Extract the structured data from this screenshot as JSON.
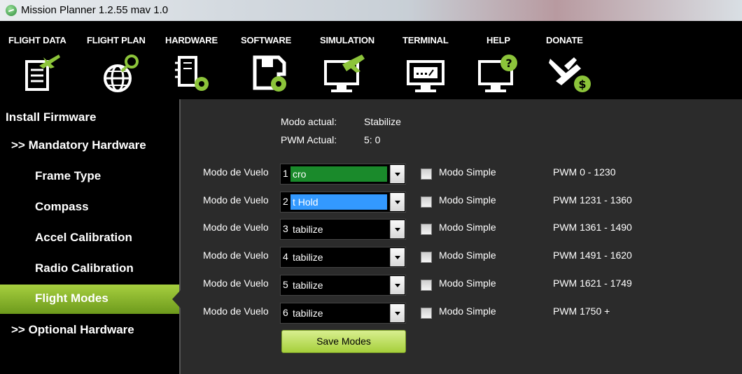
{
  "window": {
    "title": "Mission Planner 1.2.55 mav 1.0"
  },
  "menu": [
    {
      "label": "FLIGHT DATA",
      "icon": "flight-data-icon"
    },
    {
      "label": "FLIGHT PLAN",
      "icon": "globe-pin-icon"
    },
    {
      "label": "HARDWARE",
      "icon": "hardware-gear-icon"
    },
    {
      "label": "SOFTWARE",
      "icon": "save-gear-icon"
    },
    {
      "label": "SIMULATION",
      "icon": "monitor-plane-icon"
    },
    {
      "label": "TERMINAL",
      "icon": "monitor-terminal-icon"
    },
    {
      "label": "HELP",
      "icon": "monitor-question-icon"
    },
    {
      "label": "DONATE",
      "icon": "plane-dollar-icon"
    }
  ],
  "sidebar": {
    "items": [
      {
        "label": "Install Firmware"
      },
      {
        "label": ">> Mandatory Hardware"
      },
      {
        "label": "Frame Type"
      },
      {
        "label": "Compass"
      },
      {
        "label": "Accel Calibration"
      },
      {
        "label": "Radio Calibration"
      },
      {
        "label": "Flight Modes",
        "active": true
      },
      {
        "label": ">> Optional Hardware"
      }
    ]
  },
  "status": {
    "mode_label": "Modo actual:",
    "mode_value": "Stabilize",
    "pwm_label": "PWM Actual:",
    "pwm_value": "5: 0"
  },
  "modes": [
    {
      "label": "Modo de Vuelo",
      "num": "1",
      "value": "cro",
      "simple_label": "Modo Simple",
      "pwm": "PWM 0 - 1230"
    },
    {
      "label": "Modo de Vuelo",
      "num": "2",
      "value": "t Hold",
      "simple_label": "Modo Simple",
      "pwm": "PWM 1231 - 1360"
    },
    {
      "label": "Modo de Vuelo",
      "num": "3",
      "value": "tabilize",
      "simple_label": "Modo Simple",
      "pwm": "PWM 1361 - 1490"
    },
    {
      "label": "Modo de Vuelo",
      "num": "4",
      "value": "tabilize",
      "simple_label": "Modo Simple",
      "pwm": "PWM 1491 - 1620"
    },
    {
      "label": "Modo de Vuelo",
      "num": "5",
      "value": "tabilize",
      "simple_label": "Modo Simple",
      "pwm": "PWM 1621 - 1749"
    },
    {
      "label": "Modo de Vuelo",
      "num": "6",
      "value": "tabilize",
      "simple_label": "Modo Simple",
      "pwm": "PWM 1750 +"
    }
  ],
  "save_label": "Save Modes",
  "colors": {
    "accent": "#8cc43a",
    "panel": "#2b2b2b",
    "highlight_green": "#1a8a2b",
    "highlight_blue": "#3399ff"
  }
}
